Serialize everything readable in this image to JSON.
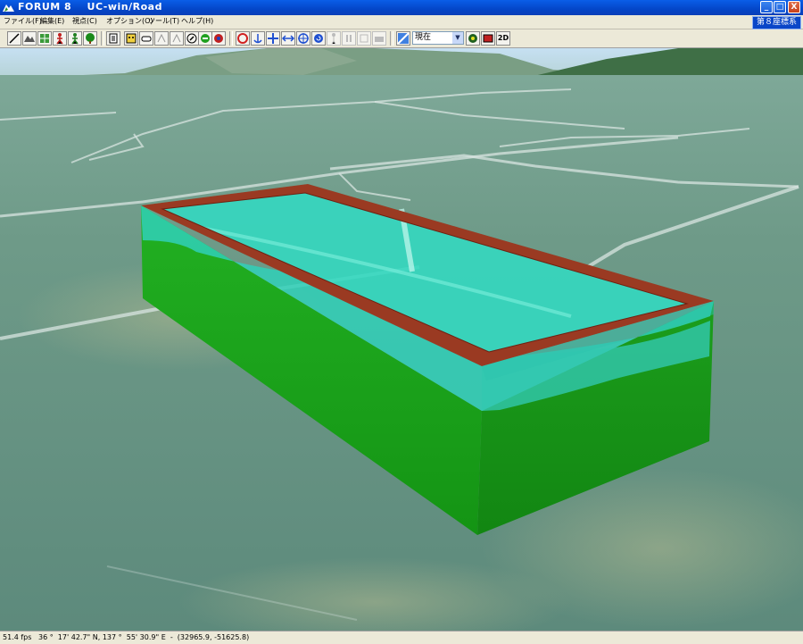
{
  "window": {
    "title": "FORUM 8    UC-win/Road",
    "buttons": {
      "minimize": "_",
      "maximize": "□",
      "close": "X"
    }
  },
  "menu": {
    "items": [
      "ファイル(F)",
      "編集(E)",
      "視点(C)",
      "オプション(O)",
      "ツール(T)",
      "ヘルプ(H)"
    ],
    "coordinate_system": "第８座標系"
  },
  "toolbar": {
    "time_value": "現在",
    "view_2d_label": "2D",
    "icons": [
      "road-icon",
      "terrain-icon",
      "grid-icon",
      "person-red-icon",
      "person-green-icon",
      "tree-icon",
      "document-icon",
      "face-icon",
      "car-icon",
      "route-icon",
      "route-icon",
      "navigate-icon",
      "rotate-icon",
      "model-icon",
      "rotate-view-icon",
      "anchor-icon",
      "move-view-icon",
      "pan-icon",
      "target-icon",
      "refresh-icon",
      "walk-icon",
      "pause-icon",
      "record-icon",
      "camera-icon",
      "clock-icon",
      "settings-icon",
      "photo-icon"
    ]
  },
  "status": {
    "fps": "51.4 fps",
    "coords": "36 °  17' 42.7\" N, 137 °  55' 30.9\" E  -  (32965.9, -51625.8)"
  },
  "colors": {
    "title_bar": "#0446c8",
    "water": "#30d0b8",
    "embankment": "#1aa81a",
    "rim": "#9a3a22",
    "terrain": "#6e9a88"
  }
}
